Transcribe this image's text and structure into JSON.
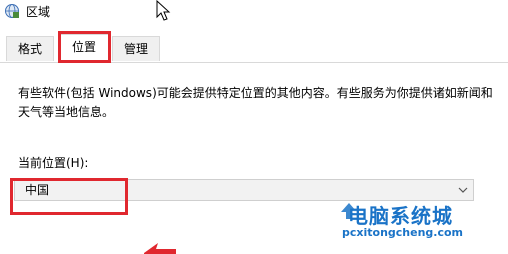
{
  "window": {
    "title": "区域"
  },
  "tabs": [
    {
      "label": "格式",
      "active": false
    },
    {
      "label": "位置",
      "active": true
    },
    {
      "label": "管理",
      "active": false
    }
  ],
  "location": {
    "description": "有些软件(包括 Windows)可能会提供特定位置的其他内容。有些服务为你提供诸如新闻和天气等当地信息。",
    "field_label": "当前位置(H):",
    "selected_value": "中国"
  },
  "watermark": {
    "title": "电脑系统城",
    "url": "pcxitongcheng.com"
  },
  "colors": {
    "highlight": "#e0282f",
    "watermark": "#1a73c7"
  }
}
